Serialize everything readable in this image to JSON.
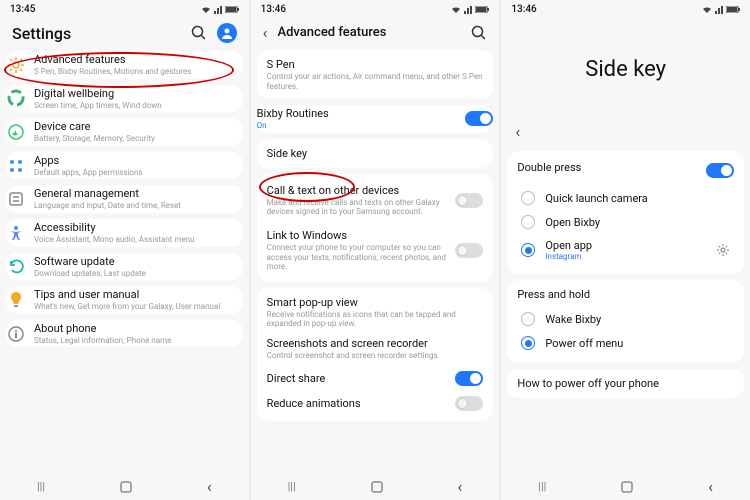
{
  "status": {
    "time1": "13:45",
    "time2": "13:46",
    "time3": "13:46"
  },
  "screen1": {
    "title": "Settings",
    "items": [
      {
        "icon": "gear-orange",
        "title": "Advanced features",
        "sub": "S Pen, Bixby Routines, Motions and gestures"
      },
      {
        "icon": "wellbeing",
        "title": "Digital wellbeing",
        "sub": "Screen time, App timers, Wind down"
      },
      {
        "icon": "device-care",
        "title": "Device care",
        "sub": "Battery, Storage, Memory, Security"
      },
      {
        "icon": "apps",
        "title": "Apps",
        "sub": "Default apps, App permissions"
      },
      {
        "icon": "general",
        "title": "General management",
        "sub": "Language and input, Date and time, Reset"
      },
      {
        "icon": "accessibility",
        "title": "Accessibility",
        "sub": "Voice Assistant, Mono audio, Assistant menu"
      },
      {
        "icon": "update",
        "title": "Software update",
        "sub": "Download updates, Last update"
      },
      {
        "icon": "tips",
        "title": "Tips and user manual",
        "sub": "What's new, Get more from your Galaxy, User manual"
      },
      {
        "icon": "about",
        "title": "About phone",
        "sub": "Status, Legal information, Phone name"
      }
    ]
  },
  "screen2": {
    "title": "Advanced features",
    "items": [
      {
        "title": "S Pen",
        "sub": "Control your air actions, Air command menu, and other S Pen features."
      },
      {
        "title": "Bixby Routines",
        "sub": "On",
        "subBlue": true,
        "toggle": "on"
      },
      {
        "title": "Side key"
      },
      {
        "title": "Call & text on other devices",
        "sub": "Make and receive calls and texts on other Galaxy devices signed in to your Samsung account.",
        "toggle": "off"
      },
      {
        "title": "Link to Windows",
        "sub": "Connect your phone to your computer so you can access your texts, notifications, recent photos, and more.",
        "toggle": "off"
      },
      {
        "title": "Smart pop-up view",
        "sub": "Receive notifications as icons that can be tapped and expanded in pop-up view."
      },
      {
        "title": "Screenshots and screen recorder",
        "sub": "Control screenshot and screen recorder settings."
      },
      {
        "title": "Direct share",
        "toggle": "on"
      },
      {
        "title": "Reduce animations",
        "toggle": "off"
      }
    ]
  },
  "screen3": {
    "title": "Side key",
    "doublePress": {
      "label": "Double press",
      "options": [
        {
          "label": "Quick launch camera",
          "selected": false
        },
        {
          "label": "Open Bixby",
          "selected": false
        },
        {
          "label": "Open app",
          "sub": "Instagram",
          "selected": true,
          "gear": true
        }
      ]
    },
    "pressHold": {
      "label": "Press and hold",
      "options": [
        {
          "label": "Wake Bixby",
          "selected": false
        },
        {
          "label": "Power off menu",
          "selected": true
        }
      ]
    },
    "footer": "How to power off your phone"
  }
}
